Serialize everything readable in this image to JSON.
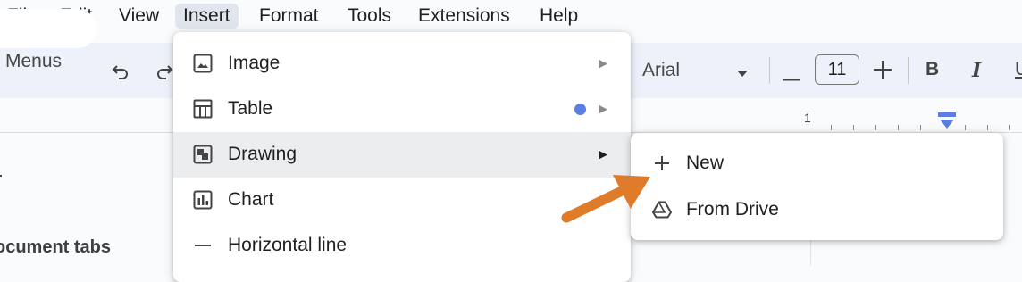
{
  "menubar": {
    "items": [
      "File",
      "Edit",
      "View",
      "Insert",
      "Format",
      "Tools",
      "Extensions",
      "Help"
    ],
    "active": "Insert"
  },
  "toolbar": {
    "menus_label": "Menus",
    "font_name": "Arial",
    "font_size": "11",
    "bold": "B",
    "italic": "I",
    "underline": "U"
  },
  "ruler": {
    "label": "1"
  },
  "document": {
    "tabs_label": "ocument tabs"
  },
  "insert_menu": {
    "items": [
      {
        "label": "Image",
        "icon": "image-icon",
        "has_submenu": true
      },
      {
        "label": "Table",
        "icon": "table-icon",
        "has_submenu": true,
        "new_dot_color": "#5b7ee5"
      },
      {
        "label": "Drawing",
        "icon": "drawing-icon",
        "has_submenu": true,
        "highlighted": true
      },
      {
        "label": "Chart",
        "icon": "chart-icon",
        "has_submenu": true
      },
      {
        "label": "Horizontal line",
        "icon": "horizontal-line-icon",
        "has_submenu": false
      }
    ]
  },
  "drawing_submenu": {
    "items": [
      {
        "label": "New",
        "icon": "plus-icon"
      },
      {
        "label": "From Drive",
        "icon": "drive-icon"
      }
    ]
  },
  "colors": {
    "annotation_arrow": "#e07b2a",
    "active_menu_bg": "#e1e6ee",
    "toolbar_bg": "#edf2fa",
    "ruler_marker": "#5b7ee5"
  }
}
